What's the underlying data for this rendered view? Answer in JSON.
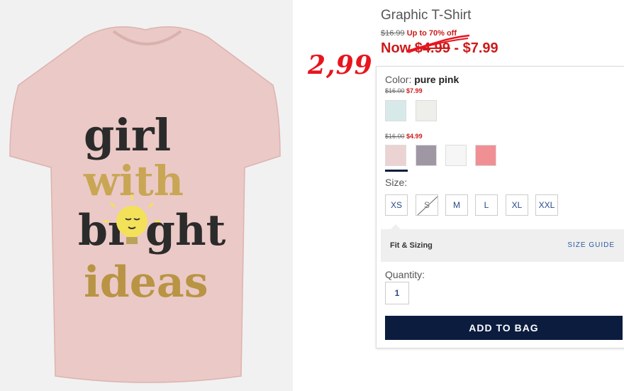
{
  "product": {
    "title": "Graphic T-Shirt",
    "original_price": "$16.99",
    "discount_text": "Up to 70% off",
    "now_prefix": "Now",
    "now_low": "$4.99",
    "now_sep": " - ",
    "now_high": "$7.99"
  },
  "annotation": {
    "handwritten_price": "2,99"
  },
  "shirt_print": {
    "line1": "girl",
    "line2": "with",
    "line3_a": "br",
    "line3_b": "ght",
    "line4": "ideas"
  },
  "color": {
    "label": "Color:",
    "selected": "pure pink",
    "groups": [
      {
        "orig": "$16.00",
        "sale": "$7.99",
        "swatches": [
          "#d8e9ea",
          "#eeeeea"
        ]
      },
      {
        "orig": "$16.00",
        "sale": "$4.99",
        "swatches": [
          "#ecd3d3",
          "#9f98a4",
          "#f6f6f6",
          "#f09095"
        ]
      }
    ]
  },
  "size": {
    "label": "Size:",
    "options": [
      "XS",
      "S",
      "M",
      "L",
      "XL",
      "XXL"
    ],
    "unavailable": [
      "S"
    ]
  },
  "fit": {
    "label": "Fit & Sizing",
    "guide": "SIZE GUIDE"
  },
  "quantity": {
    "label": "Quantity:",
    "value": "1"
  },
  "cta": {
    "add_to_bag": "ADD TO BAG"
  },
  "colors": {
    "accent_red": "#cc1b1b",
    "navy": "#0b1c3f",
    "shirt_pink": "#ebc9c6"
  }
}
